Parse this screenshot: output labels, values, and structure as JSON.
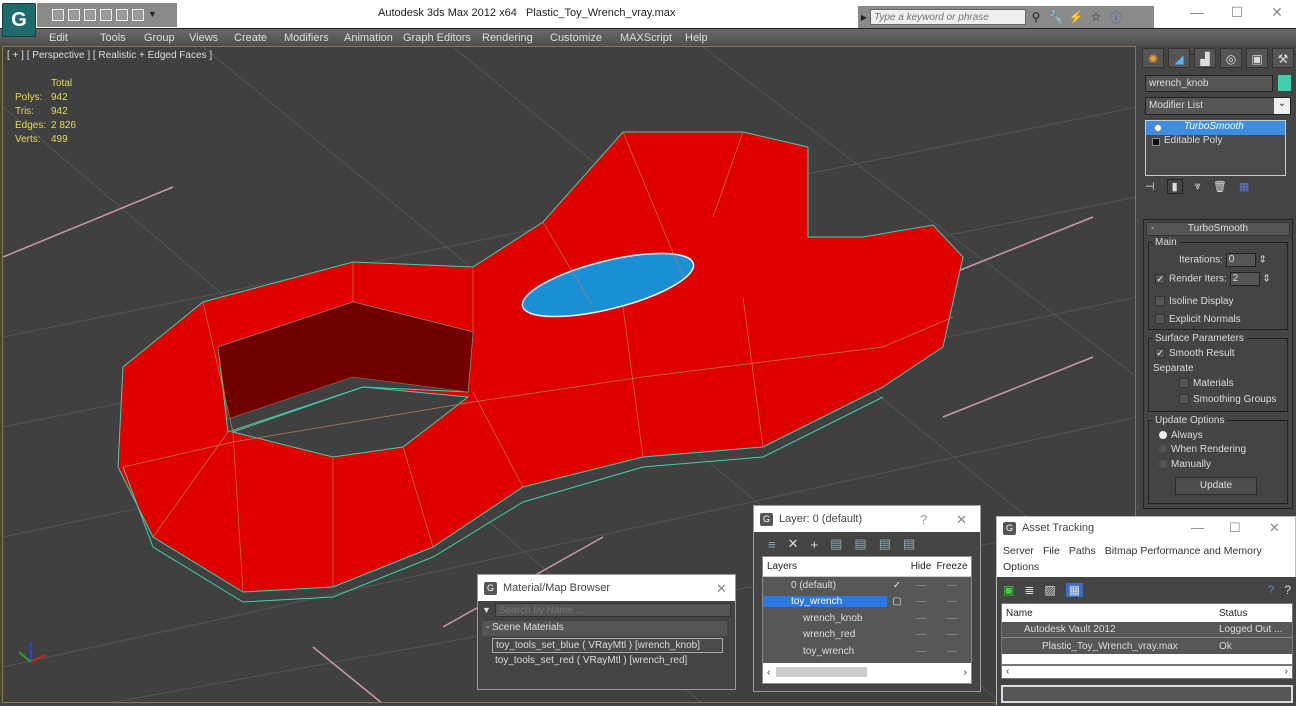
{
  "app": {
    "title": "Autodesk 3ds Max  2012 x64",
    "file": "Plastic_Toy_Wrench_vray.max",
    "logo": "3ds-max-logo",
    "search_placeholder": "Type a keyword or phrase"
  },
  "menu": [
    "Edit",
    "Tools",
    "Group",
    "Views",
    "Create",
    "Modifiers",
    "Animation",
    "Graph Editors",
    "Rendering",
    "Customize",
    "MAXScript",
    "Help"
  ],
  "viewport": {
    "label": "[ + ] [ Perspective ] [ Realistic + Edged Faces ]",
    "stats": {
      "header": "Total",
      "rows": [
        {
          "k": "Polys:",
          "v": "942"
        },
        {
          "k": "Tris:",
          "v": "942"
        },
        {
          "k": "Edges:",
          "v": "2 826"
        },
        {
          "k": "Verts:",
          "v": "499"
        }
      ]
    },
    "colors": {
      "object": "#e00000",
      "knob": "#1a8fd6",
      "wire": "#3fd0b0",
      "grid": "#5a5a5a"
    }
  },
  "command_panel": {
    "object_name": "wrench_knob",
    "object_color": "#3fd0b0",
    "modifier_list": "Modifier List",
    "stack": [
      {
        "label": "TurboSmooth",
        "selected": true
      },
      {
        "label": "Editable Poly",
        "selected": false
      }
    ],
    "rollout": {
      "title": "TurboSmooth",
      "main_label": "Main",
      "iterations_label": "Iterations:",
      "iterations": "0",
      "render_iters_label": "Render Iters:",
      "render_iters": "2",
      "render_iters_checked": true,
      "isoline": "Isoline Display",
      "explicit": "Explicit Normals",
      "surface_label": "Surface Parameters",
      "smooth_result": "Smooth Result",
      "separate": "Separate",
      "materials": "Materials",
      "smoothing_groups": "Smoothing Groups",
      "update_label": "Update Options",
      "always": "Always",
      "when_rendering": "When Rendering",
      "manually": "Manually",
      "update_btn": "Update"
    }
  },
  "layer_dialog": {
    "title": "Layer: 0 (default)",
    "help": "?",
    "cols": [
      "Layers",
      "Hide",
      "Freeze"
    ],
    "rows": [
      {
        "name": "0 (default)",
        "check": "✓",
        "indent": 1,
        "sel": false
      },
      {
        "name": "toy_wrench",
        "check": "",
        "indent": 1,
        "sel": true
      },
      {
        "name": "wrench_knob",
        "indent": 2
      },
      {
        "name": "wrench_red",
        "indent": 2
      },
      {
        "name": "toy_wrench",
        "indent": 2
      }
    ]
  },
  "material_browser": {
    "title": "Material/Map Browser",
    "search_placeholder": "Search by Name ...",
    "section": "- Scene Materials",
    "items": [
      "toy_tools_set_blue  ( VRayMtl ) [wrench_knob]",
      "toy_tools_set_red  ( VRayMtl ) [wrench_red]"
    ]
  },
  "asset_tracking": {
    "title": "Asset Tracking",
    "menu": [
      "Server",
      "File",
      "Paths",
      "Bitmap Performance and Memory",
      "Options"
    ],
    "cols": [
      "Name",
      "Status"
    ],
    "rows": [
      {
        "name": "Autodesk Vault 2012",
        "status": "Logged Out ..."
      },
      {
        "name": "Plastic_Toy_Wrench_vray.max",
        "status": "Ok"
      }
    ]
  }
}
